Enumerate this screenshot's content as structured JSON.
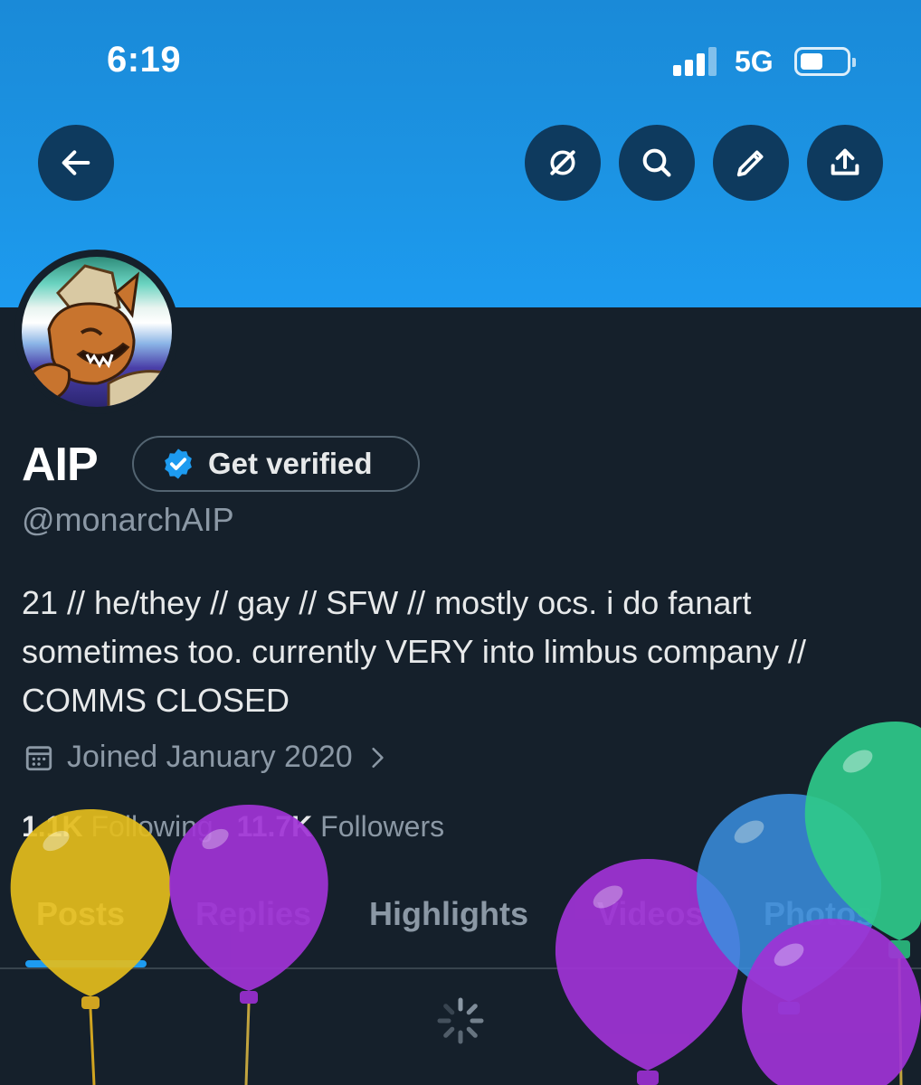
{
  "status_bar": {
    "time": "6:19",
    "network": "5G"
  },
  "toolbar": {
    "back_icon": "arrow-left-icon",
    "actions": [
      "grok-icon",
      "search-icon",
      "pencil-icon",
      "share-icon"
    ]
  },
  "profile": {
    "display_name": "AIP",
    "verify_label": "Get verified",
    "handle": "@monarchAIP",
    "bio": "21 // he/they // gay // SFW // mostly ocs. i do fanart sometimes too. currently VERY into limbus company // COMMS CLOSED",
    "joined": "Joined January 2020",
    "following_count": "1.1K",
    "following_label": "Following",
    "followers_count": "11.7K",
    "followers_label": "Followers"
  },
  "tabs": [
    {
      "label": "Posts",
      "active": true
    },
    {
      "label": "Replies",
      "active": false
    },
    {
      "label": "Highlights",
      "active": false
    },
    {
      "label": "Videos",
      "active": false
    },
    {
      "label": "Photos",
      "active": false
    }
  ],
  "colors": {
    "banner": "#1d9bf0",
    "background": "#15202b",
    "accent": "#1d9bf0",
    "muted_text": "#8b98a5"
  }
}
